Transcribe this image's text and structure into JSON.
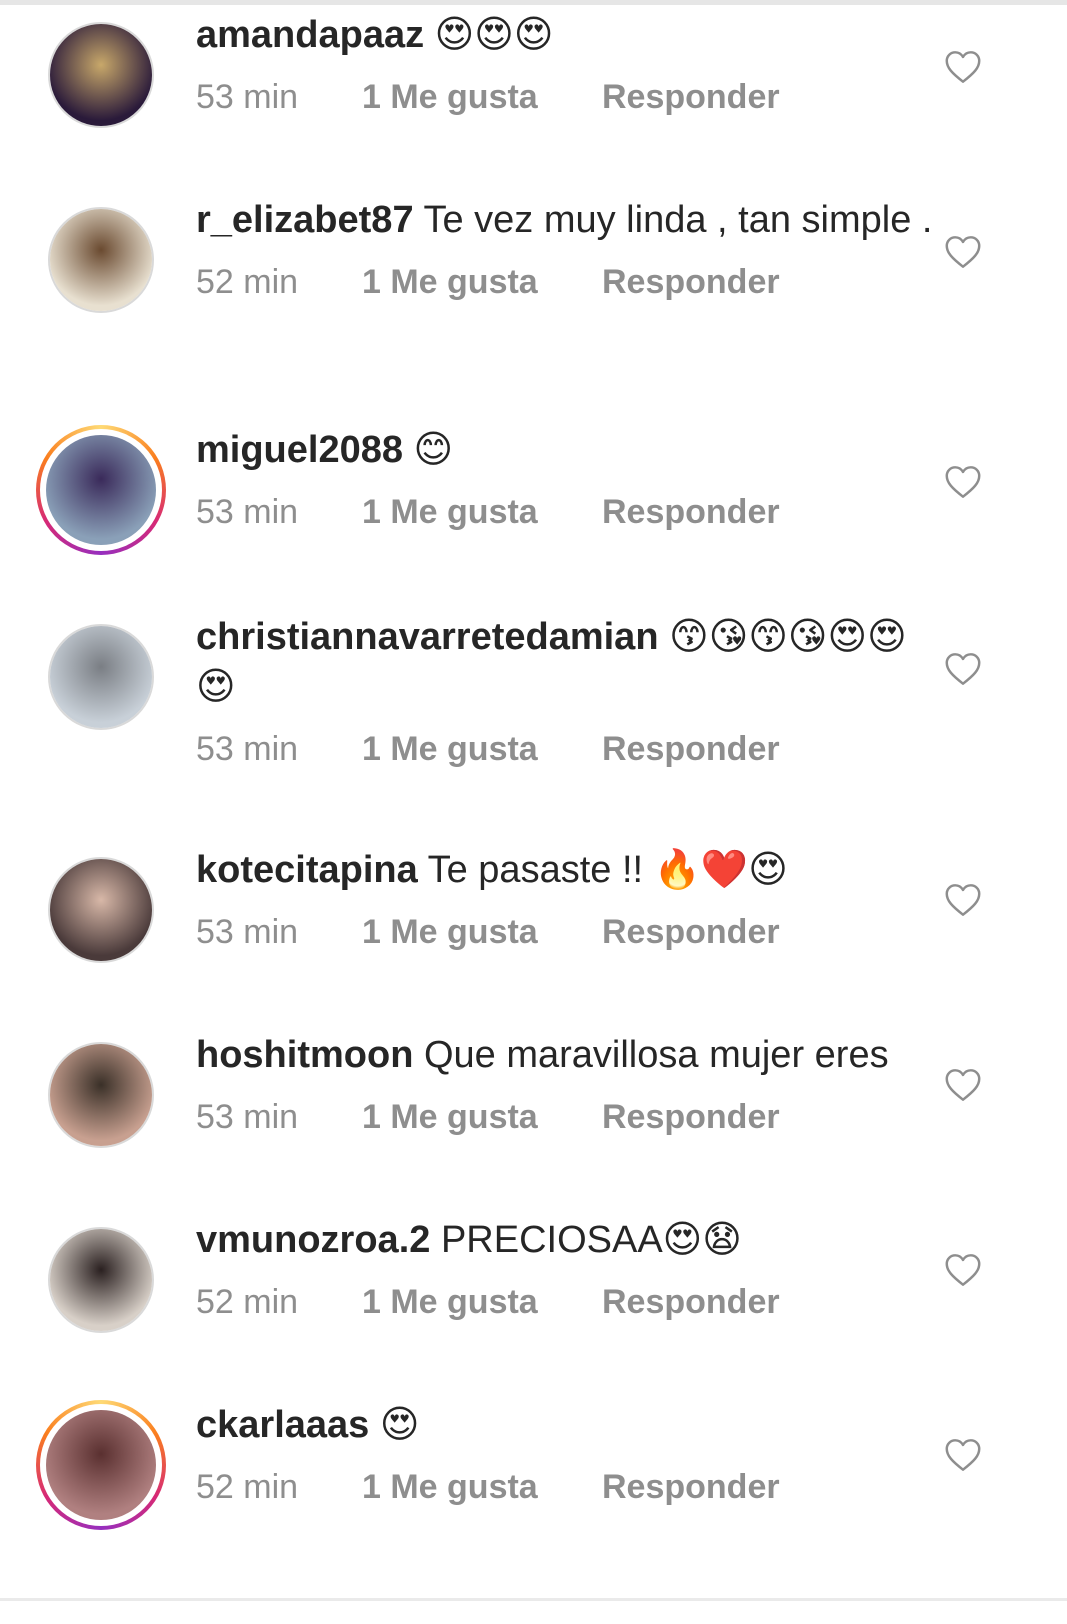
{
  "comments": [
    {
      "username": "amandapaaz",
      "text": " 😍😍😍",
      "time": "53 min",
      "likes": "1 Me gusta",
      "reply": "Responder",
      "story_ring": false,
      "avatar_colors": [
        "#2a1a3a",
        "#c8a86a"
      ]
    },
    {
      "username": "r_elizabet87",
      "text": " Te vez muy linda , tan simple .",
      "time": "52 min",
      "likes": "1 Me gusta",
      "reply": "Responder",
      "story_ring": false,
      "avatar_colors": [
        "#e8e0d0",
        "#6a4a30"
      ]
    },
    {
      "username": "miguel2088",
      "text": " 😊",
      "time": "53 min",
      "likes": "1 Me gusta",
      "reply": "Responder",
      "story_ring": true,
      "avatar_colors": [
        "#8aa0b8",
        "#3a2a5a"
      ]
    },
    {
      "username": "christiannavarretedamian",
      "text": " 😙😘😙😘😍😍😍",
      "time": "53 min",
      "likes": "1 Me gusta",
      "reply": "Responder",
      "story_ring": false,
      "avatar_colors": [
        "#c8d0d8",
        "#7a7e84"
      ]
    },
    {
      "username": "kotecitapina",
      "text": " Te pasaste !! 🔥❤️😍",
      "time": "53 min",
      "likes": "1 Me gusta",
      "reply": "Responder",
      "story_ring": false,
      "avatar_colors": [
        "#4a3a3a",
        "#d8b8a8"
      ]
    },
    {
      "username": "hoshitmoon",
      "text": " Que maravillosa mujer eres",
      "time": "53 min",
      "likes": "1 Me gusta",
      "reply": "Responder",
      "story_ring": false,
      "avatar_colors": [
        "#c8a090",
        "#3a3028"
      ]
    },
    {
      "username": "vmunozroa.2",
      "text": " PRECIOSAA😍😧",
      "time": "52 min",
      "likes": "1 Me gusta",
      "reply": "Responder",
      "story_ring": false,
      "avatar_colors": [
        "#d8d0c8",
        "#2a2020"
      ]
    },
    {
      "username": "ckarlaaas",
      "text": " 😍",
      "time": "52 min",
      "likes": "1 Me gusta",
      "reply": "Responder",
      "story_ring": true,
      "avatar_colors": [
        "#b08080",
        "#5a3030"
      ]
    }
  ],
  "icons": {
    "like": "heart-outline-icon"
  },
  "colors": {
    "text": "#262626",
    "meta": "#8e8e8e",
    "heart": "#8e8e8e"
  }
}
